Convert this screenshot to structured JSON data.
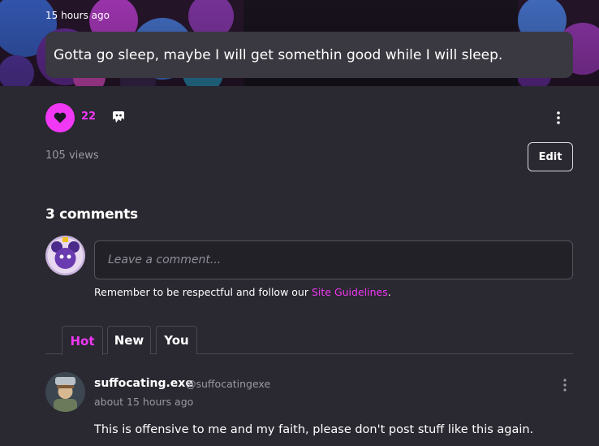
{
  "post": {
    "timestamp": "15 hours ago",
    "status_text": "Gotta go sleep, maybe I will get somethin good while I will sleep.",
    "like_count": "22",
    "views": "105 views",
    "edit_label": "Edit"
  },
  "comments": {
    "heading": "3 comments",
    "input_placeholder": "Leave a comment...",
    "guidelines_prefix": "Remember to be respectful and follow our ",
    "guidelines_link": "Site Guidelines",
    "guidelines_suffix": ".",
    "tabs": [
      {
        "label": "Hot",
        "active": true
      },
      {
        "label": "New",
        "active": false
      },
      {
        "label": "You",
        "active": false
      }
    ],
    "items": [
      {
        "author": "suffocating.exe",
        "handle": "@suffocatingexe",
        "time": "about 15 hours ago",
        "text": "This is offensive to me and my faith, please don't post stuff like this again."
      }
    ]
  },
  "colors": {
    "accent": "#f038f5",
    "background": "#2a2830",
    "bubble": "#3a3840"
  },
  "icons": {
    "like": "heart-icon",
    "ghost": "ghost-icon",
    "more": "kebab-icon"
  }
}
